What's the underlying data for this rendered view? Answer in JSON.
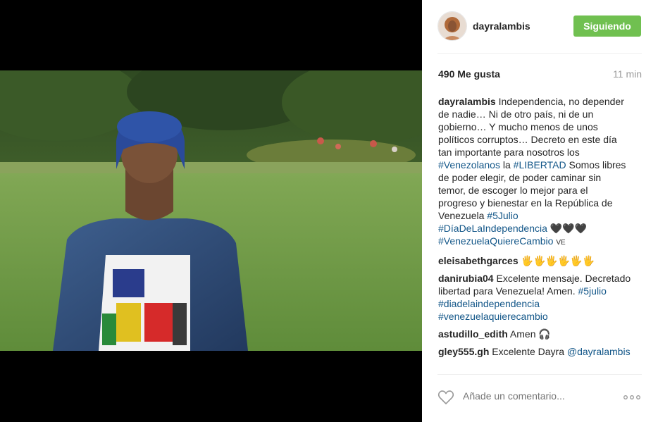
{
  "post": {
    "username": "dayralambis",
    "follow_label": "Siguiendo",
    "likes": "490 Me gusta",
    "time": "11 min"
  },
  "caption": {
    "user": "dayralambis",
    "lines": [
      "Independencia, no depender",
      "de nadie… Ni de otro país, ni de un",
      "gobierno… Y mucho menos de unos",
      "políticos corruptos… Decreto en este día",
      "tan importante para nosotros los"
    ],
    "tag_venezolanos": "#Venezolanos",
    "word_la": "la",
    "tag_libertad": "#LIBERTAD",
    "text_after_libertad": "Somos libres",
    "lines2": [
      "de poder elegir, de poder caminar sin",
      "temor, de escoger lo mejor para el",
      "progreso y bienestar en la República de"
    ],
    "word_venezuela": "Venezuela",
    "tag_5julio": "#5Julio",
    "tag_dia": "#DíaDeLaIndependencia",
    "emoji_hearts": "🖤🖤🖤",
    "tag_quiere": "#VenezuelaQuiereCambio",
    "ve_text": "VE"
  },
  "comments": [
    {
      "user": "eleisabethgarces",
      "text": "🖐🖐🖐🖐🖐🖐"
    },
    {
      "user": "danirubia04",
      "text1": "Excelente mensaje. Decretado",
      "text2": "libertad para Venezuela! Amen.",
      "tag1": "#5julio",
      "tag2": "#diadelaindependencia",
      "tag3": "#venezuelaquierecambio"
    },
    {
      "user": "astudillo_edith",
      "text": "Amen 🎧"
    },
    {
      "user": "gley555.gh",
      "text": "Excelente Dayra",
      "mention": "@dayralambis"
    }
  ],
  "footer": {
    "placeholder": "Añade un comentario...",
    "heart_icon": "heart-outline-icon",
    "more_icon": "more-options-icon"
  },
  "colors": {
    "follow_button": "#70c050",
    "hashtag": "#125688",
    "muted": "#999999"
  }
}
